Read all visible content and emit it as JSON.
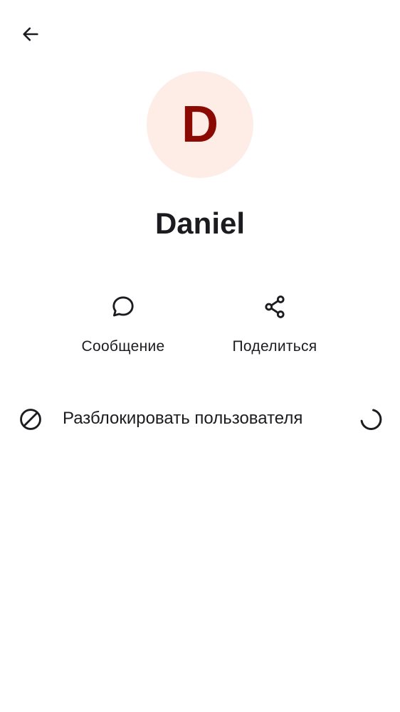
{
  "header": {
    "back_icon": "arrow-left-icon"
  },
  "profile": {
    "avatar_letter": "D",
    "avatar_bg_color": "#fdede6",
    "avatar_letter_color": "#8b0a04",
    "name": "Daniel"
  },
  "actions": [
    {
      "label": "Сообщение",
      "icon": "chat-bubble-icon"
    },
    {
      "label": "Поделиться",
      "icon": "share-icon"
    }
  ],
  "unblock": {
    "label": "Разблокировать пользователя",
    "icon": "block-icon",
    "status_icon": "loading-spinner-icon"
  }
}
